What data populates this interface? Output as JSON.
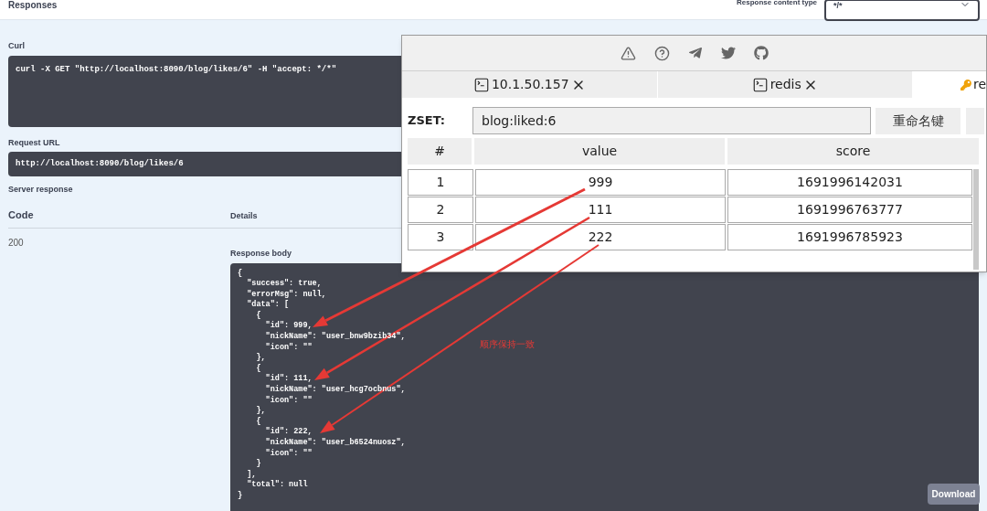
{
  "responses_header": {
    "title": "Responses",
    "content_type_label": "Response content type",
    "content_type_value": "*/*"
  },
  "curl": {
    "label": "Curl",
    "command": "curl -X GET \"http://localhost:8090/blog/likes/6\" -H \"accept: */*\""
  },
  "request_url": {
    "label": "Request URL",
    "value": "http://localhost:8090/blog/likes/6"
  },
  "server_response": {
    "label": "Server response",
    "columns": [
      "Code",
      "Details"
    ],
    "code": "200",
    "body_label": "Response body",
    "body_lines": [
      "{",
      "  \"success\": true,",
      "  \"errorMsg\": null,",
      "  \"data\": [",
      "    {",
      "      \"id\": 999,",
      "      \"nickName\": \"user_bnw9bzib34\",",
      "      \"icon\": \"\"",
      "    },",
      "    {",
      "      \"id\": 111,",
      "      \"nickName\": \"user_hcg7ocbnus\",",
      "      \"icon\": \"\"",
      "    },",
      "    {",
      "      \"id\": 222,",
      "      \"nickName\": \"user_b6524nuosz\",",
      "      \"icon\": \"\"",
      "    }",
      "  ],",
      "  \"total\": null",
      "}"
    ],
    "download": "Download"
  },
  "redis_window": {
    "tabs": [
      {
        "label": "10.1.50.157",
        "kind": "terminal",
        "closable": true,
        "selected": false
      },
      {
        "label": "redis",
        "kind": "terminal",
        "closable": true,
        "selected": false
      },
      {
        "label": "re",
        "kind": "key",
        "closable": false,
        "selected": true
      }
    ],
    "key_type": "ZSET:",
    "key_name": "blog:liked:6",
    "rename_button": "重命名键",
    "columns": [
      "#",
      "value",
      "score"
    ],
    "rows": [
      {
        "index": "1",
        "value": "999",
        "score": "1691996142031"
      },
      {
        "index": "2",
        "value": "111",
        "score": "1691996763777"
      },
      {
        "index": "3",
        "value": "222",
        "score": "1691996785923"
      }
    ]
  },
  "annotation": {
    "note": "顺序保持一致"
  }
}
